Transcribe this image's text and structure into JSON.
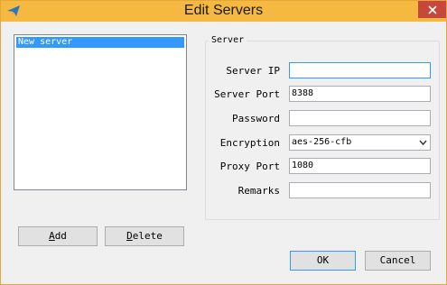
{
  "window": {
    "title": "Edit Servers"
  },
  "servers": [
    {
      "label": "New server",
      "selected": true
    }
  ],
  "server_group": {
    "title": "Server",
    "fields": {
      "server_ip": {
        "label": "Server IP",
        "value": ""
      },
      "server_port": {
        "label": "Server Port",
        "value": "8388"
      },
      "password": {
        "label": "Password",
        "value": ""
      },
      "encryption": {
        "label": "Encryption",
        "value": "aes-256-cfb"
      },
      "proxy_port": {
        "label": "Proxy Port",
        "value": "1080"
      },
      "remarks": {
        "label": "Remarks",
        "value": ""
      }
    }
  },
  "buttons": {
    "add": {
      "mnemonic": "A",
      "rest": "dd"
    },
    "delete": {
      "mnemonic": "D",
      "rest": "elete"
    },
    "ok": "OK",
    "cancel": "Cancel"
  },
  "colors": {
    "titlebar": "#f5b840",
    "close": "#c7483b",
    "selection": "#3399ff"
  },
  "icons": {
    "app": "paper-plane-icon",
    "close": "close-icon",
    "dropdown": "chevron-down-icon"
  }
}
